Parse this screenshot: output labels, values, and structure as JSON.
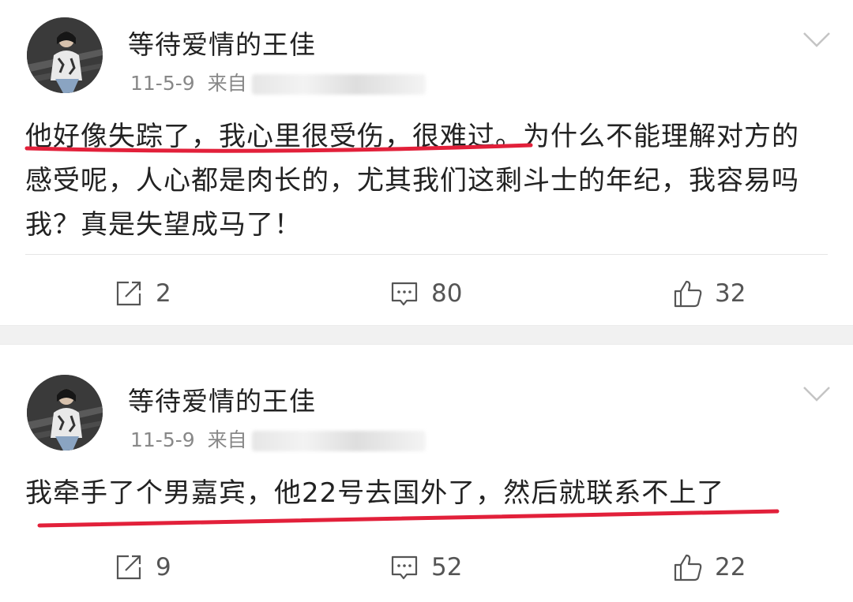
{
  "posts": [
    {
      "username": "等待爱情的王佳",
      "date": "11-5-9",
      "source_prefix": "来自",
      "content": "他好像失踪了，我心里很受伤，很难过。为什么不能理解对方的感受呢，人心都是肉长的，尤其我们这剩斗士的年纪，我容易吗我？真是失望成马了！",
      "reposts": "2",
      "comments": "80",
      "likes": "32"
    },
    {
      "username": "等待爱情的王佳",
      "date": "11-5-9",
      "source_prefix": "来自",
      "content": "我牵手了个男嘉宾，他22号去国外了，然后就联系不上了",
      "reposts": "9",
      "comments": "52",
      "likes": "22"
    }
  ],
  "colors": {
    "underline": "#e2203a",
    "separator": "#f1f1f1",
    "meta_text": "#888888",
    "body_text": "#222222"
  },
  "icons": {
    "repost": "repost-icon",
    "comment": "comment-icon",
    "like": "like-icon",
    "more": "chevron-down-icon"
  }
}
